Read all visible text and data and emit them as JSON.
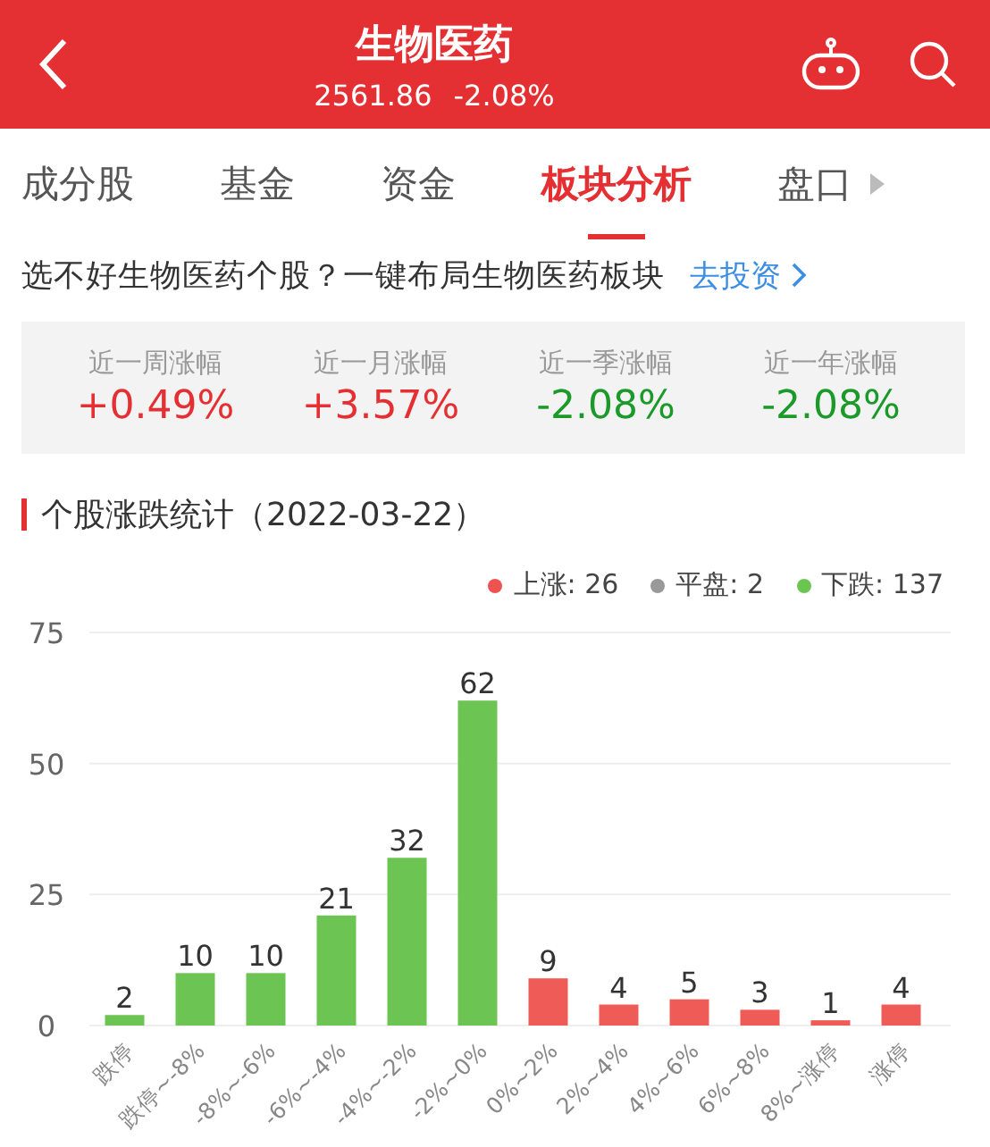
{
  "header": {
    "title": "生物医药",
    "price": "2561.86",
    "change": "-2.08%"
  },
  "tabs": [
    {
      "label": "成分股",
      "selected": false
    },
    {
      "label": "基金",
      "selected": false
    },
    {
      "label": "资金",
      "selected": false
    },
    {
      "label": "板块分析",
      "selected": true
    },
    {
      "label": "盘口",
      "selected": false
    }
  ],
  "banner": {
    "text": "选不好生物医药个股？一键布局生物医药板块",
    "link": "去投资"
  },
  "stats": [
    {
      "label": "近一周涨幅",
      "value": "+0.49%",
      "color": "#e53033"
    },
    {
      "label": "近一月涨幅",
      "value": "+3.57%",
      "color": "#e53033"
    },
    {
      "label": "近一季涨幅",
      "value": "-2.08%",
      "color": "#1b9a2a"
    },
    {
      "label": "近一年涨幅",
      "value": "-2.08%",
      "color": "#1b9a2a"
    }
  ],
  "section_title": "个股涨跌统计（2022-03-22）",
  "legend": [
    {
      "label": "上涨: 26",
      "color": "#ef5350"
    },
    {
      "label": "平盘: 2",
      "color": "#999999"
    },
    {
      "label": "下跌: 137",
      "color": "#6cc553"
    }
  ],
  "chart_data": {
    "type": "bar",
    "categories": [
      "跌停",
      "跌停~-8%",
      "-8%~-6%",
      "-6%~-4%",
      "-4%~-2%",
      "-2%~0%",
      "0%~2%",
      "2%~4%",
      "4%~6%",
      "6%~8%",
      "8%~涨停",
      "涨停"
    ],
    "series": [
      {
        "color": "#6cc553",
        "values": [
          2,
          10,
          10,
          21,
          32,
          62,
          null,
          null,
          null,
          null,
          null,
          null
        ]
      },
      {
        "color": "#ef5c57",
        "values": [
          null,
          null,
          null,
          null,
          null,
          null,
          9,
          4,
          5,
          3,
          1,
          4
        ]
      }
    ],
    "ylim": [
      0,
      75
    ],
    "yticks": [
      0,
      25,
      50,
      75
    ],
    "data_labels": true
  }
}
